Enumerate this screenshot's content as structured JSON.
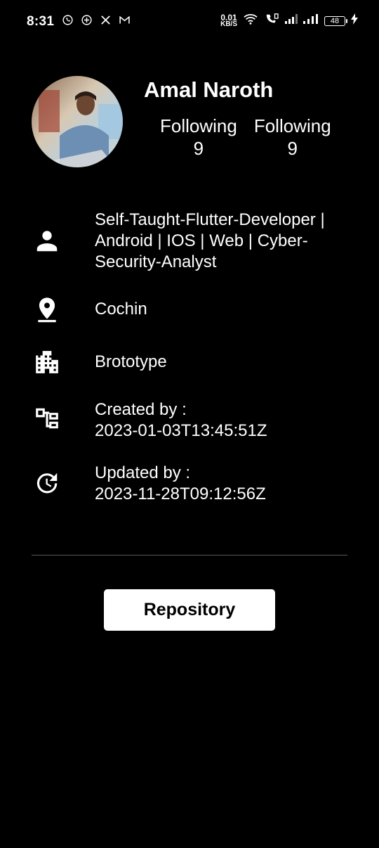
{
  "status_bar": {
    "time": "8:31",
    "net_speed_value": "0.01",
    "net_speed_unit": "KB/S",
    "battery_level": "48",
    "left_icons": [
      "whatsapp-icon",
      "chat-icon",
      "x-icon",
      "gmail-icon"
    ],
    "right_icons": [
      "wifi-icon",
      "volte-call-icon",
      "signal-icon",
      "signal-icon",
      "battery-icon",
      "charging-icon"
    ]
  },
  "profile": {
    "name": "Amal Naroth",
    "stats": [
      {
        "label": "Following",
        "value": "9"
      },
      {
        "label": "Following",
        "value": "9"
      }
    ]
  },
  "details": [
    {
      "icon": "person-icon",
      "text": "Self-Taught-Flutter-Developer | Android | IOS | Web | Cyber-Security-Analyst"
    },
    {
      "icon": "location-pin-icon",
      "text": "Cochin"
    },
    {
      "icon": "building-icon",
      "text": "Brototype"
    },
    {
      "icon": "account-tree-icon",
      "text_line1": "Created by :",
      "text_line2": "2023-01-03T13:45:51Z"
    },
    {
      "icon": "update-icon",
      "text_line1": "Updated by :",
      "text_line2": "2023-11-28T09:12:56Z"
    }
  ],
  "actions": {
    "repository_label": "Repository"
  },
  "colors": {
    "background": "#000000",
    "text": "#ffffff",
    "button_bg": "#ffffff",
    "button_text": "#000000",
    "divider": "#5a5a5a"
  }
}
